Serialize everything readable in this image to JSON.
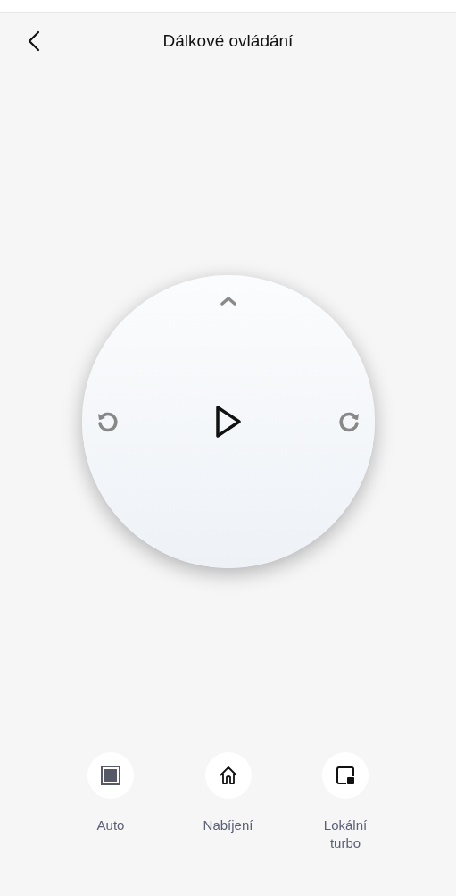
{
  "header": {
    "title": "Dálkové ovládání"
  },
  "actions": [
    {
      "kind": "stop",
      "label": "Auto"
    },
    {
      "kind": "home",
      "label": "Nabíjení"
    },
    {
      "kind": "spot",
      "label": "Lokální turbo"
    }
  ]
}
